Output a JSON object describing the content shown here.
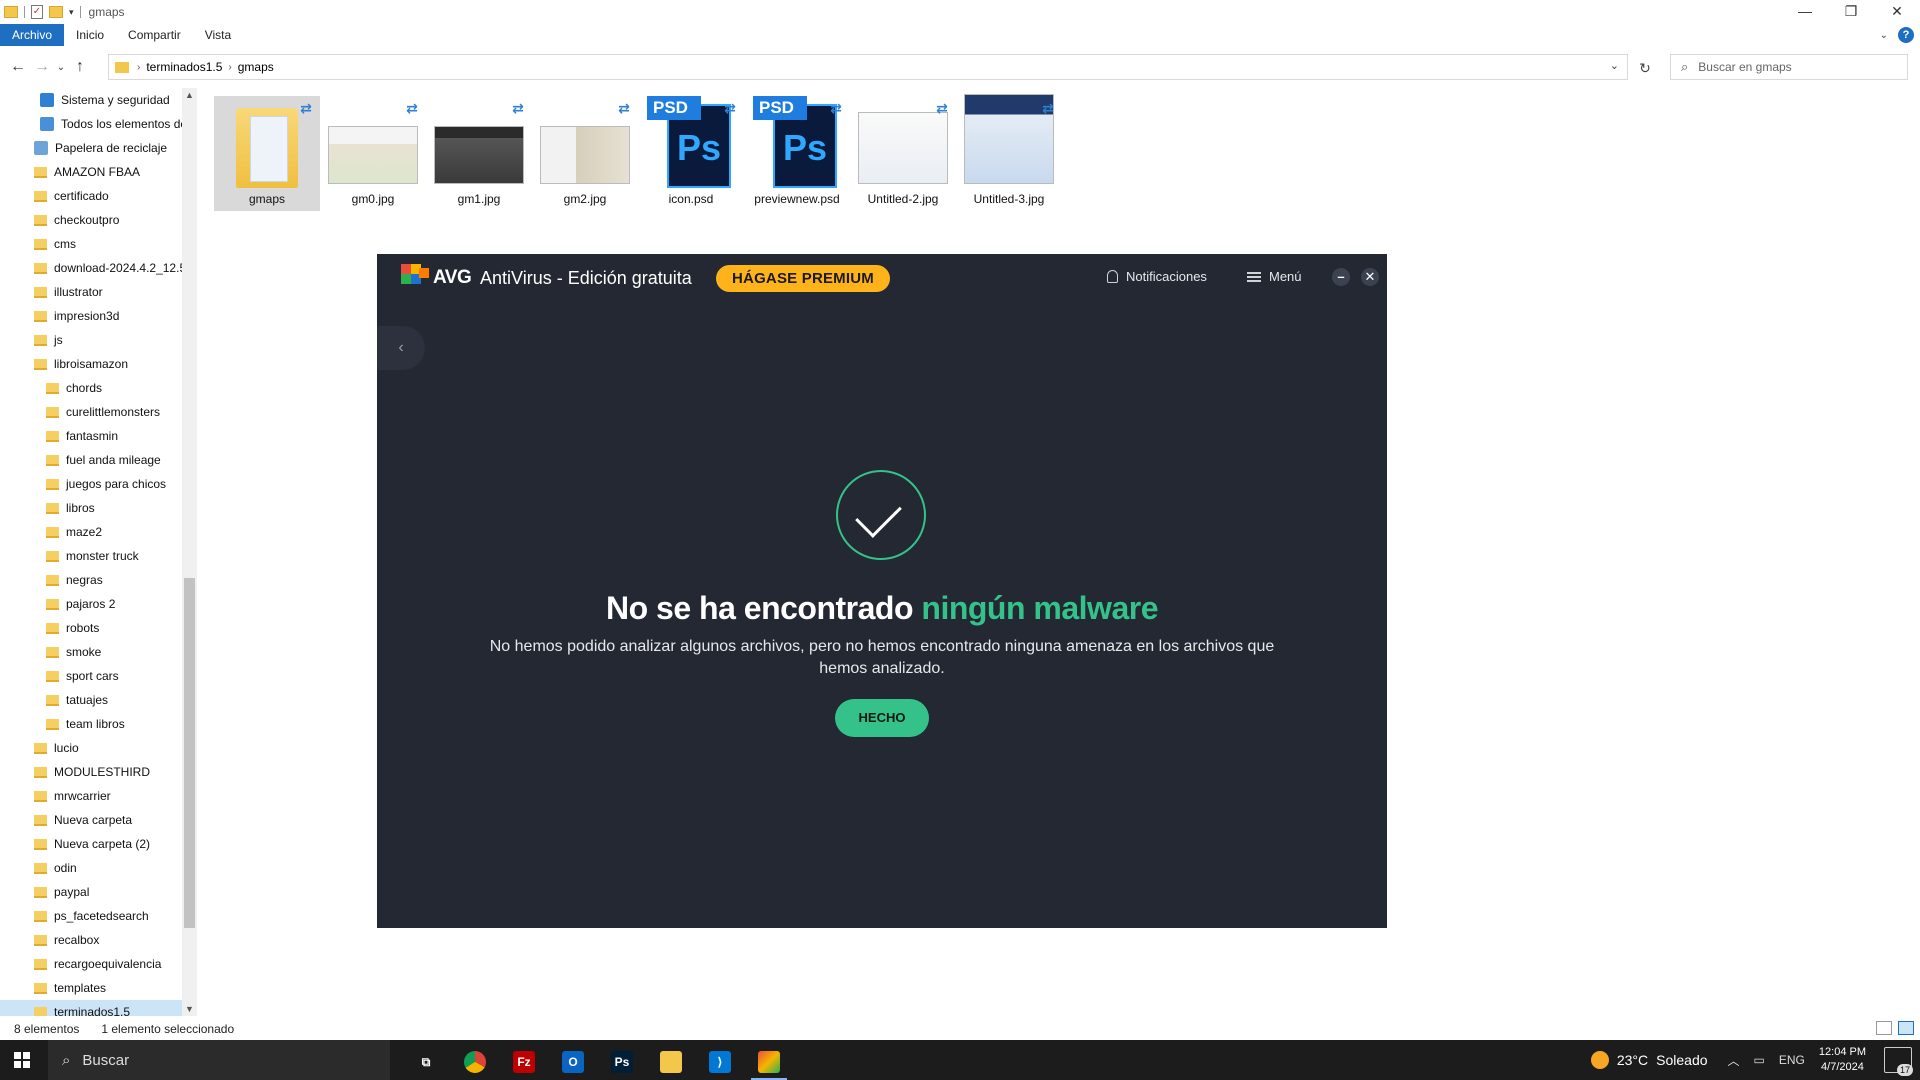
{
  "window": {
    "title": "gmaps",
    "controls": {
      "minimize": "—",
      "maximize": "❐",
      "close": "✕"
    }
  },
  "ribbon": {
    "tabs": [
      {
        "label": "Archivo",
        "active": true
      },
      {
        "label": "Inicio"
      },
      {
        "label": "Compartir"
      },
      {
        "label": "Vista"
      }
    ]
  },
  "address": {
    "crumbs": [
      "terminados1.5",
      "gmaps"
    ],
    "search_placeholder": "Buscar en gmaps"
  },
  "nav": {
    "items": [
      {
        "label": "Sistema y seguridad",
        "type": "system"
      },
      {
        "label": "Todos los elementos de",
        "type": "control"
      },
      {
        "label": "Papelera de reciclaje",
        "type": "recycle",
        "indent": 0
      },
      {
        "label": "AMAZON FBAA"
      },
      {
        "label": "certificado"
      },
      {
        "label": "checkoutpro"
      },
      {
        "label": "cms"
      },
      {
        "label": "download-2024.4.2_12.5"
      },
      {
        "label": "illustrator"
      },
      {
        "label": "impresion3d"
      },
      {
        "label": "js"
      },
      {
        "label": "libroisamazon"
      },
      {
        "label": "chords",
        "sub": true
      },
      {
        "label": "curelittlemonsters",
        "sub": true
      },
      {
        "label": "fantasmin",
        "sub": true
      },
      {
        "label": "fuel anda mileage",
        "sub": true
      },
      {
        "label": "juegos para chicos",
        "sub": true
      },
      {
        "label": "libros",
        "sub": true
      },
      {
        "label": "maze2",
        "sub": true
      },
      {
        "label": "monster truck",
        "sub": true
      },
      {
        "label": "negras",
        "sub": true
      },
      {
        "label": "pajaros 2",
        "sub": true
      },
      {
        "label": "robots",
        "sub": true
      },
      {
        "label": "smoke",
        "sub": true
      },
      {
        "label": "sport cars",
        "sub": true
      },
      {
        "label": "tatuajes",
        "sub": true
      },
      {
        "label": "team libros",
        "sub": true
      },
      {
        "label": "lucio"
      },
      {
        "label": "MODULESTHIRD"
      },
      {
        "label": "mrwcarrier"
      },
      {
        "label": "Nueva carpeta"
      },
      {
        "label": "Nueva carpeta (2)"
      },
      {
        "label": "odin"
      },
      {
        "label": "paypal"
      },
      {
        "label": "ps_facetedsearch"
      },
      {
        "label": "recalbox"
      },
      {
        "label": "recargoequivalencia"
      },
      {
        "label": "templates"
      },
      {
        "label": "terminados1.5",
        "selected": true
      }
    ]
  },
  "files": [
    {
      "name": "gmaps",
      "kind": "folder",
      "selected": true
    },
    {
      "name": "gm0.jpg",
      "kind": "img-light"
    },
    {
      "name": "gm1.jpg",
      "kind": "img-dark"
    },
    {
      "name": "gm2.jpg",
      "kind": "img-mixed"
    },
    {
      "name": "icon.psd",
      "kind": "psd"
    },
    {
      "name": "previewnew.psd",
      "kind": "psd"
    },
    {
      "name": "Untitled-2.jpg",
      "kind": "img-white"
    },
    {
      "name": "Untitled-3.jpg",
      "kind": "img-tall"
    }
  ],
  "psd_badge": {
    "top": "PSD",
    "body": "Ps"
  },
  "avg": {
    "brand": "AVG",
    "product": "AntiVirus - Edición gratuita",
    "premium_label": "HÁGASE PREMIUM",
    "notifications_label": "Notificaciones",
    "menu_label": "Menú",
    "headline_part1": "No se ha encontrado ",
    "headline_part2": "ningún malware",
    "description": "No hemos podido analizar algunos archivos, pero no hemos encontrado ninguna amenaza en los archivos que hemos analizado.",
    "done_label": "HECHO",
    "colors": {
      "accent_green": "#35c28a",
      "premium": "#ffb31a",
      "bg": "#232833"
    }
  },
  "status": {
    "count": "8 elementos",
    "selection": "1 elemento seleccionado"
  },
  "taskbar": {
    "search_label": "Buscar",
    "apps": [
      {
        "name": "task-view",
        "glyph": "⧉",
        "color": "#1c1c1c"
      },
      {
        "name": "chrome",
        "glyph": "",
        "color": "#db4437"
      },
      {
        "name": "filezilla",
        "glyph": "Fz",
        "color": "#bf0000"
      },
      {
        "name": "outlook",
        "glyph": "O",
        "color": "#0a64c2"
      },
      {
        "name": "photoshop",
        "glyph": "Ps",
        "color": "#001e36"
      },
      {
        "name": "file-explorer",
        "glyph": "",
        "color": "#f3c74b"
      },
      {
        "name": "vscode",
        "glyph": "⟩",
        "color": "#0078d4"
      },
      {
        "name": "avg",
        "glyph": "",
        "color": "#ff7a00",
        "active": true
      }
    ],
    "weather": "23°C",
    "weather_desc": "Soleado",
    "lang": "ENG",
    "time": "12:04 PM",
    "date": "4/7/2024",
    "notif_count": "17"
  }
}
